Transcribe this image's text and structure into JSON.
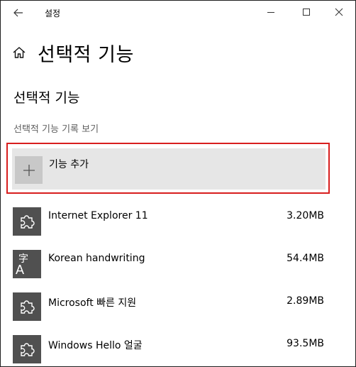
{
  "window": {
    "title": "설정"
  },
  "header": {
    "title": "선택적 기능"
  },
  "section": {
    "title": "선택적 기능",
    "history_link": "선택적 기능 기록 보기"
  },
  "add_feature": {
    "label": "기능 추가",
    "icon": "plus-icon"
  },
  "features": [
    {
      "name": "Internet Explorer 11",
      "size": "3.20MB",
      "icon": "puzzle-icon"
    },
    {
      "name": "Korean handwriting",
      "size": "54.4MB",
      "icon": "language-icon",
      "icon_glyph_big": "字",
      "icon_glyph_small": "A"
    },
    {
      "name": "Microsoft 빠른 지원",
      "size": "2.89MB",
      "icon": "puzzle-icon"
    },
    {
      "name": "Windows Hello 얼굴",
      "size": "93.5MB",
      "icon": "puzzle-icon"
    }
  ],
  "colors": {
    "highlight_border": "#d81e1e",
    "feature_tile": "#505050",
    "add_background": "#e6e6e6"
  }
}
